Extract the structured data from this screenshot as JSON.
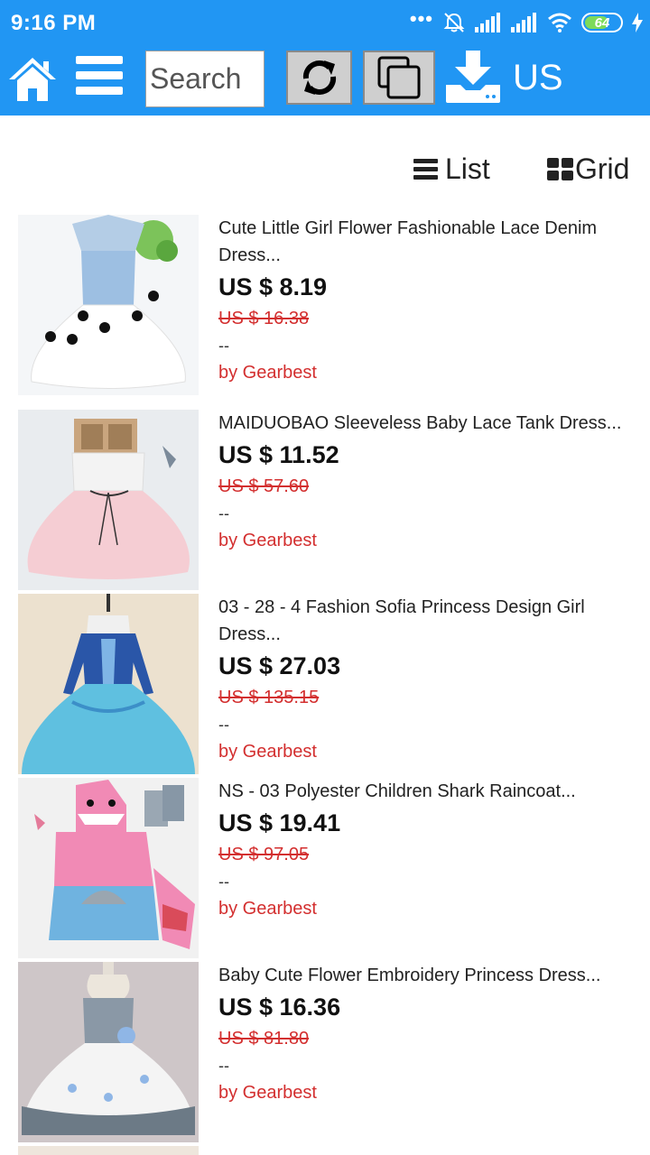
{
  "status_bar": {
    "time": "9:16 PM",
    "battery": "64"
  },
  "toolbar": {
    "search_placeholder": "Search",
    "region": "US"
  },
  "view_switch": {
    "list_label": "List",
    "grid_label": "Grid"
  },
  "products": [
    {
      "name": "Cute Little Girl Flower Fashionable Lace Denim Dress...",
      "price": "US $ 8.19",
      "old_price": "US $ 16.38",
      "extra": "--",
      "seller": "by Gearbest"
    },
    {
      "name": "MAIDUOBAO Sleeveless Baby Lace Tank Dress...",
      "price": "US $ 11.52",
      "old_price": "US $ 57.60",
      "extra": "--",
      "seller": "by Gearbest"
    },
    {
      "name": "03 - 28 - 4 Fashion Sofia Princess Design Girl Dress...",
      "price": "US $ 27.03",
      "old_price": "US $ 135.15",
      "extra": "--",
      "seller": "by Gearbest"
    },
    {
      "name": "NS - 03 Polyester Children Shark Raincoat...",
      "price": "US $ 19.41",
      "old_price": "US $ 97.05",
      "extra": "--",
      "seller": "by Gearbest"
    },
    {
      "name": "Baby Cute Flower Embroidery Princess Dress...",
      "price": "US $ 16.36",
      "old_price": "US $ 81.80",
      "extra": "--",
      "seller": "by Gearbest"
    }
  ]
}
